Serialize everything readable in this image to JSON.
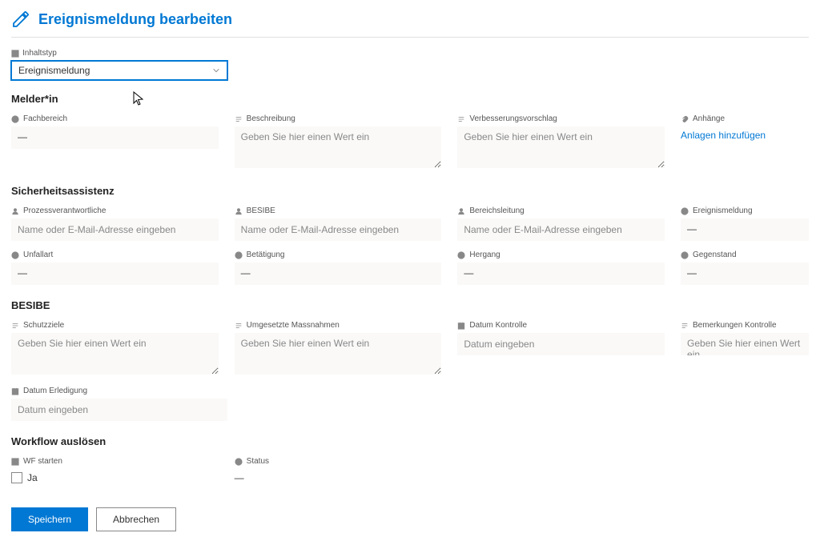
{
  "header": {
    "title": "Ereignismeldung bearbeiten"
  },
  "contentType": {
    "label": "Inhaltstyp",
    "value": "Ereignismeldung"
  },
  "section_melder": {
    "title": "Melder*in",
    "fachbereich": {
      "label": "Fachbereich",
      "value": "—"
    },
    "beschreibung": {
      "label": "Beschreibung",
      "placeholder": "Geben Sie hier einen Wert ein"
    },
    "verbesserung": {
      "label": "Verbesserungsvorschlag",
      "placeholder": "Geben Sie hier einen Wert ein"
    },
    "anhaenge": {
      "label": "Anhänge",
      "link": "Anlagen hinzufügen"
    }
  },
  "section_sicherheit": {
    "title": "Sicherheitsassistenz",
    "prozessverantwortliche": {
      "label": "Prozessverantwortliche",
      "placeholder": "Name oder E-Mail-Adresse eingeben"
    },
    "besibe": {
      "label": "BESIBE",
      "placeholder": "Name oder E-Mail-Adresse eingeben"
    },
    "bereichsleitung": {
      "label": "Bereichsleitung",
      "placeholder": "Name oder E-Mail-Adresse eingeben"
    },
    "ereignismeldung": {
      "label": "Ereignismeldung",
      "value": "—"
    },
    "unfallart": {
      "label": "Unfallart",
      "value": "—"
    },
    "betaetigung": {
      "label": "Betätigung",
      "value": "—"
    },
    "hergang": {
      "label": "Hergang",
      "value": "—"
    },
    "gegenstand": {
      "label": "Gegenstand",
      "value": "—"
    }
  },
  "section_besibe": {
    "title": "BESIBE",
    "schutzziele": {
      "label": "Schutzziele",
      "placeholder": "Geben Sie hier einen Wert ein"
    },
    "massnahmen": {
      "label": "Umgesetzte Massnahmen",
      "placeholder": "Geben Sie hier einen Wert ein"
    },
    "datumKontrolle": {
      "label": "Datum Kontrolle",
      "placeholder": "Datum eingeben"
    },
    "bemerkungenKontrolle": {
      "label": "Bemerkungen Kontrolle",
      "placeholder": "Geben Sie hier einen Wert ein"
    },
    "datumErledigung": {
      "label": "Datum Erledigung",
      "placeholder": "Datum eingeben"
    }
  },
  "section_workflow": {
    "title": "Workflow auslösen",
    "wfStarten": {
      "label": "WF starten",
      "option": "Ja"
    },
    "status": {
      "label": "Status",
      "value": "—"
    }
  },
  "footer": {
    "save": "Speichern",
    "cancel": "Abbrechen"
  }
}
